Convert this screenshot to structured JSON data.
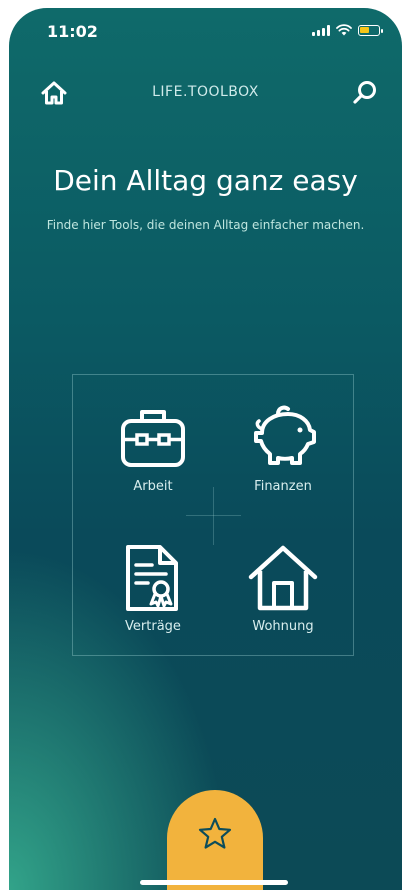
{
  "status_bar": {
    "time": "11:02"
  },
  "header": {
    "title": "LIFE.TOOLBOX",
    "home_icon": "home-icon",
    "search_icon": "search-icon"
  },
  "hero": {
    "title": "Dein Alltag ganz easy",
    "subtitle": "Finde hier Tools, die deinen Alltag einfacher machen."
  },
  "categories": [
    {
      "label": "Arbeit",
      "icon": "briefcase-icon"
    },
    {
      "label": "Finanzen",
      "icon": "piggy-bank-icon"
    },
    {
      "label": "Verträge",
      "icon": "contract-icon"
    },
    {
      "label": "Wohnung",
      "icon": "house-icon"
    }
  ],
  "fab": {
    "icon": "star-icon"
  },
  "colors": {
    "accent": "#f2b33d",
    "background_top": "#0f6a6a",
    "background_bottom_left": "#34a88c"
  }
}
